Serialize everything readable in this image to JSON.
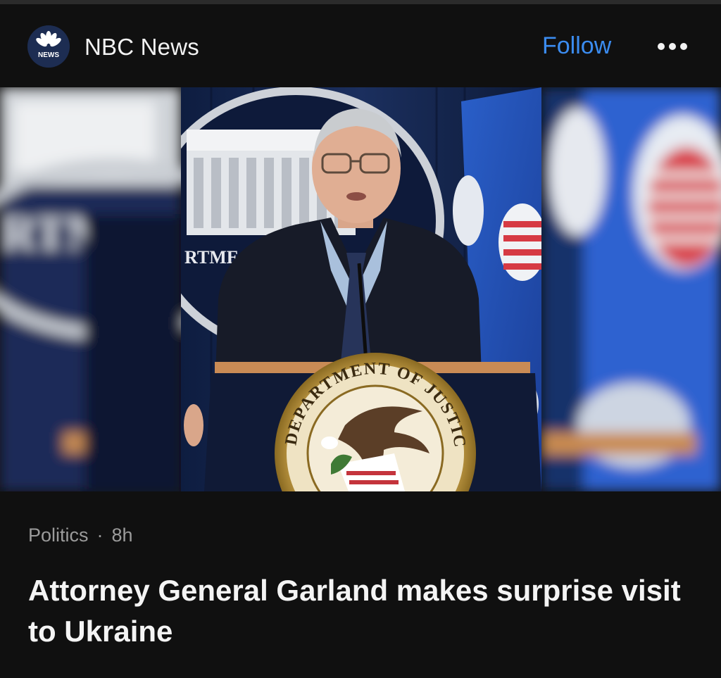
{
  "source": {
    "name": "NBC News",
    "logo_label": "NEWS",
    "follow_label": "Follow",
    "more_icon": "ellipsis-icon"
  },
  "hero_image": {
    "seal_text": "DEPARTMENT OF JUSTICE",
    "background_text": "RTME"
  },
  "article": {
    "category": "Politics",
    "separator": "·",
    "age": "8h",
    "headline": "Attorney General Garland makes surprise visit to Ukraine"
  },
  "colors": {
    "background": "#101010",
    "accent": "#3b8cf0",
    "text_primary": "#f4f4f4",
    "text_secondary": "#9b9b9b"
  }
}
